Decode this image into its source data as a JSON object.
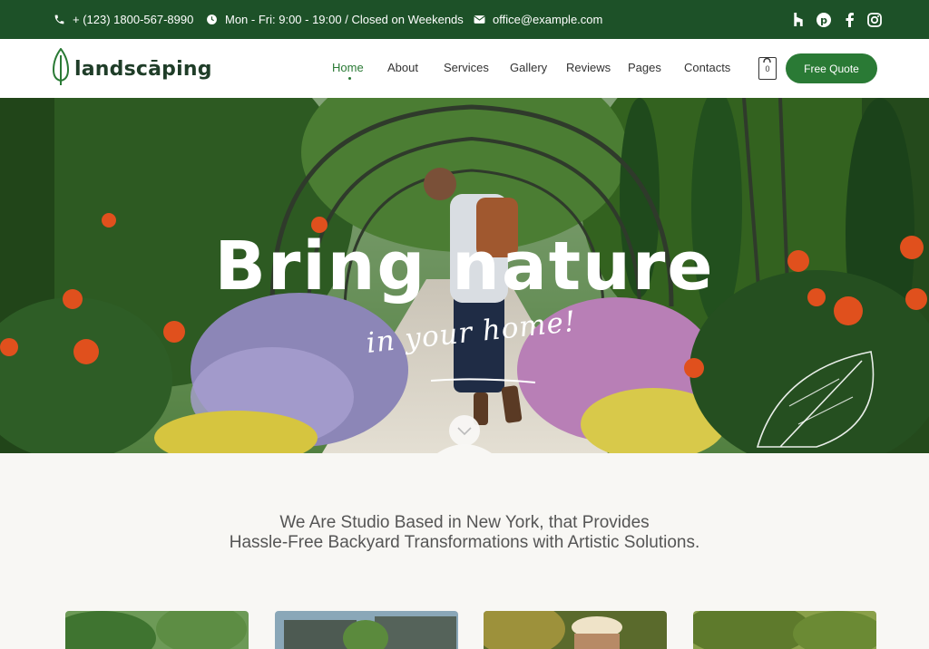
{
  "topbar": {
    "phone": "+ (123) 1800-567-8990",
    "hours": "Mon - Fri: 9:00 - 19:00 / Closed on Weekends",
    "email": "office@example.com",
    "phone_icon": "phone-icon",
    "hours_icon": "clock-icon",
    "email_icon": "envelope-icon",
    "social_icons": [
      "houzz-icon",
      "pinterest-icon",
      "facebook-icon",
      "instagram-icon"
    ],
    "background": "#1d5128"
  },
  "header": {
    "logo_text": "landscāping",
    "logo_icon": "leaf-icon",
    "nav": [
      "Home",
      "About",
      "Services",
      "Gallery",
      "Reviews",
      "Pages",
      "Contacts"
    ],
    "active_nav": "Home",
    "cart_count": "0",
    "cart_icon": "shopping-bag-icon",
    "cta": "Free Quote",
    "accent": "#2a7a35"
  },
  "hero": {
    "title": "Bring nature",
    "subtitle": "in your home!",
    "scroll_icon": "chevron-down-icon"
  },
  "intro": {
    "line1": "We Are Studio Based in New York, that Provides",
    "line2": "Hassle-Free Backyard Transformations with Artistic Solutions."
  }
}
